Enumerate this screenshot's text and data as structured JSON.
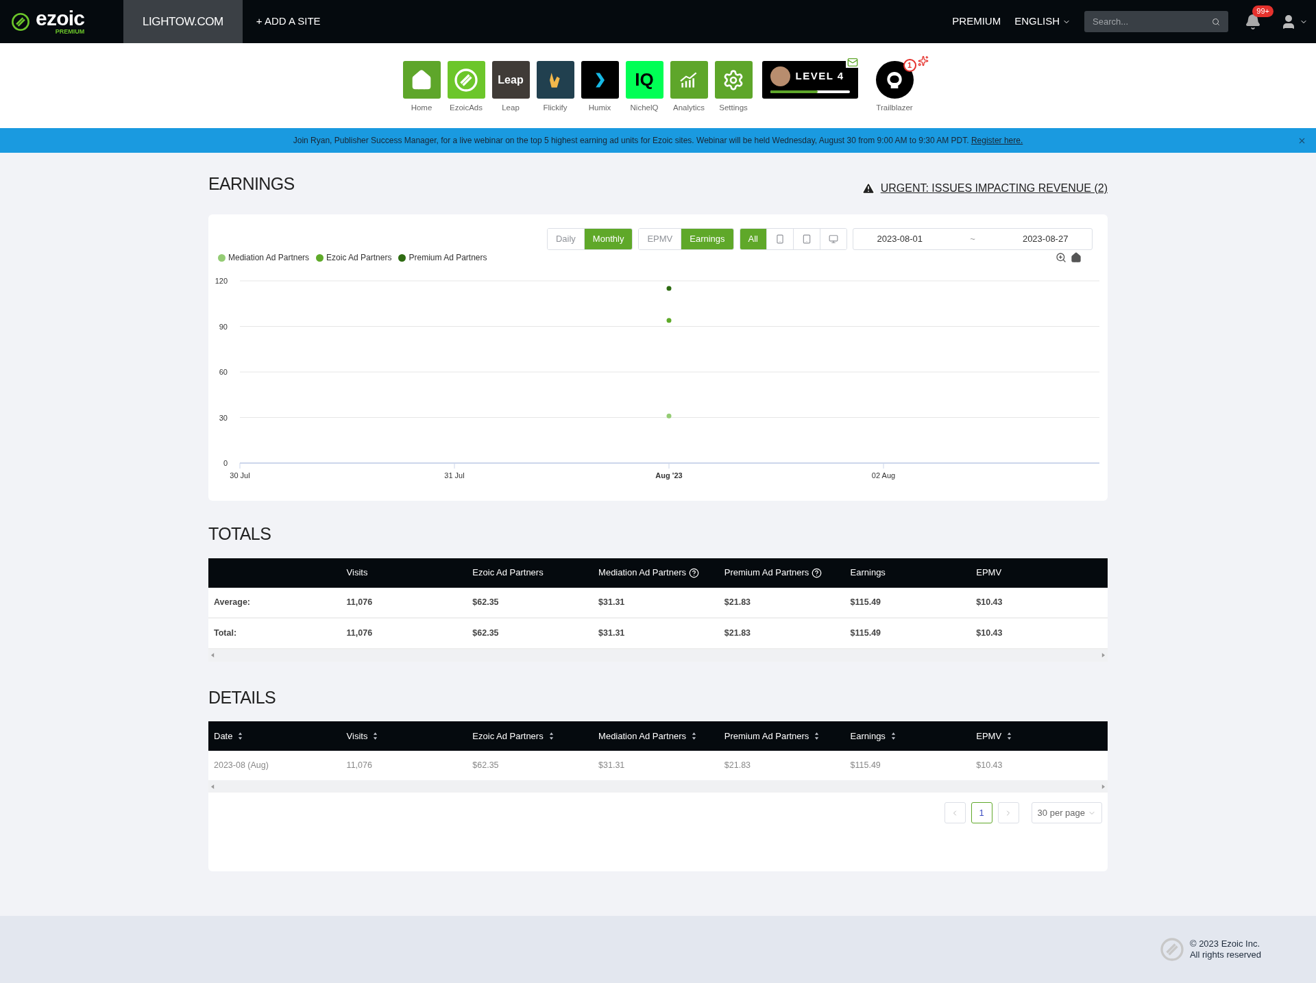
{
  "top_nav": {
    "logo": {
      "name": "ezoic",
      "tier": "PREMIUM"
    },
    "site_tab": {
      "label": "LIGHTOW.COM",
      "selected": true
    },
    "add_site": "+ ADD A SITE",
    "premium": "PREMIUM",
    "language": "ENGLISH",
    "search": {
      "placeholder": "Search..."
    },
    "notifications_badge": "99+"
  },
  "apps": [
    {
      "kind": "home",
      "label": "Home"
    },
    {
      "kind": "ezoicads",
      "label": "EzoicAds"
    },
    {
      "kind": "leap",
      "label": "Leap",
      "icon_text": "Leap"
    },
    {
      "kind": "flickify",
      "label": "Flickify"
    },
    {
      "kind": "humix",
      "label": "Humix"
    },
    {
      "kind": "nicheiq",
      "label": "NichelQ",
      "icon_text": "IQ"
    },
    {
      "kind": "analytics",
      "label": "Analytics"
    },
    {
      "kind": "settings",
      "label": "Settings"
    }
  ],
  "level_card": {
    "label": "LEVEL 4",
    "level": 0.6
  },
  "trailblazer": {
    "label": "Trailblazer",
    "badge": "1"
  },
  "banner": {
    "text": "Join Ryan, Publisher Success Manager, for a live webinar on the top 5 highest earning ad units for Ezoic sites. Webinar will be held Wednesday, August 30 from 9:00 AM to 9:30 AM PDT.",
    "link": "Register here."
  },
  "earnings": {
    "title": "EARNINGS",
    "urgent_link": "URGENT: ISSUES IMPACTING REVENUE (2)",
    "period_toggle": [
      {
        "label": "Daily",
        "selected": false
      },
      {
        "label": "Monthly",
        "selected": true
      }
    ],
    "metric_toggle": [
      {
        "label": "EPMV",
        "selected": false
      },
      {
        "label": "Earnings",
        "selected": true
      }
    ],
    "device_toggle": [
      {
        "kind": "all",
        "label": "All",
        "selected": true
      },
      {
        "kind": "phone",
        "selected": false
      },
      {
        "kind": "tablet",
        "selected": false
      },
      {
        "kind": "desktop",
        "selected": false
      }
    ],
    "date_range": {
      "start": "2023-08-01",
      "separator": "~",
      "end": "2023-08-27"
    },
    "chart_data": {
      "type": "scatter",
      "categories": [
        "30 Jul",
        "31 Jul",
        "Aug '23",
        "02 Aug"
      ],
      "grid": true,
      "ylim": [
        0,
        120
      ],
      "yticks": [
        0,
        30,
        60,
        90,
        120
      ],
      "series": [
        {
          "name": "Mediation Ad Partners",
          "color": "#94cc74",
          "values": [
            null,
            null,
            31,
            null
          ]
        },
        {
          "name": "Ezoic Ad Partners",
          "color": "#5faa2a",
          "values": [
            null,
            null,
            94,
            null
          ]
        },
        {
          "name": "Premium Ad Partners",
          "color": "#2e6b12",
          "values": [
            null,
            null,
            115,
            null
          ]
        }
      ]
    }
  },
  "totals": {
    "title": "TOTALS",
    "columns": [
      {
        "label": "Visits",
        "help": false
      },
      {
        "label": "Ezoic Ad Partners",
        "help": false
      },
      {
        "label": "Mediation Ad Partners",
        "help": true
      },
      {
        "label": "Premium Ad Partners",
        "help": true
      },
      {
        "label": "Earnings",
        "help": false
      },
      {
        "label": "EPMV",
        "help": false
      }
    ],
    "rows": [
      {
        "label": "Average:",
        "cells": [
          "11,076",
          "$62.35",
          "$31.31",
          "$21.83",
          "$115.49",
          "$10.43"
        ]
      },
      {
        "label": "Total:",
        "cells": [
          "11,076",
          "$62.35",
          "$31.31",
          "$21.83",
          "$115.49",
          "$10.43"
        ]
      }
    ]
  },
  "details": {
    "title": "DETAILS",
    "columns": [
      "Date",
      "Visits",
      "Ezoic Ad Partners",
      "Mediation Ad Partners",
      "Premium Ad Partners",
      "Earnings",
      "EPMV"
    ],
    "rows": [
      [
        "2023-08 (Aug)",
        "11,076",
        "$62.35",
        "$31.31",
        "$21.83",
        "$115.49",
        "$10.43"
      ]
    ],
    "pagination": {
      "pages": [
        {
          "label": "1",
          "selected": true
        }
      ],
      "per_page": "30 per page"
    }
  },
  "footer": {
    "copyright": "© 2023 Ezoic Inc.",
    "rights": "All rights reserved"
  }
}
